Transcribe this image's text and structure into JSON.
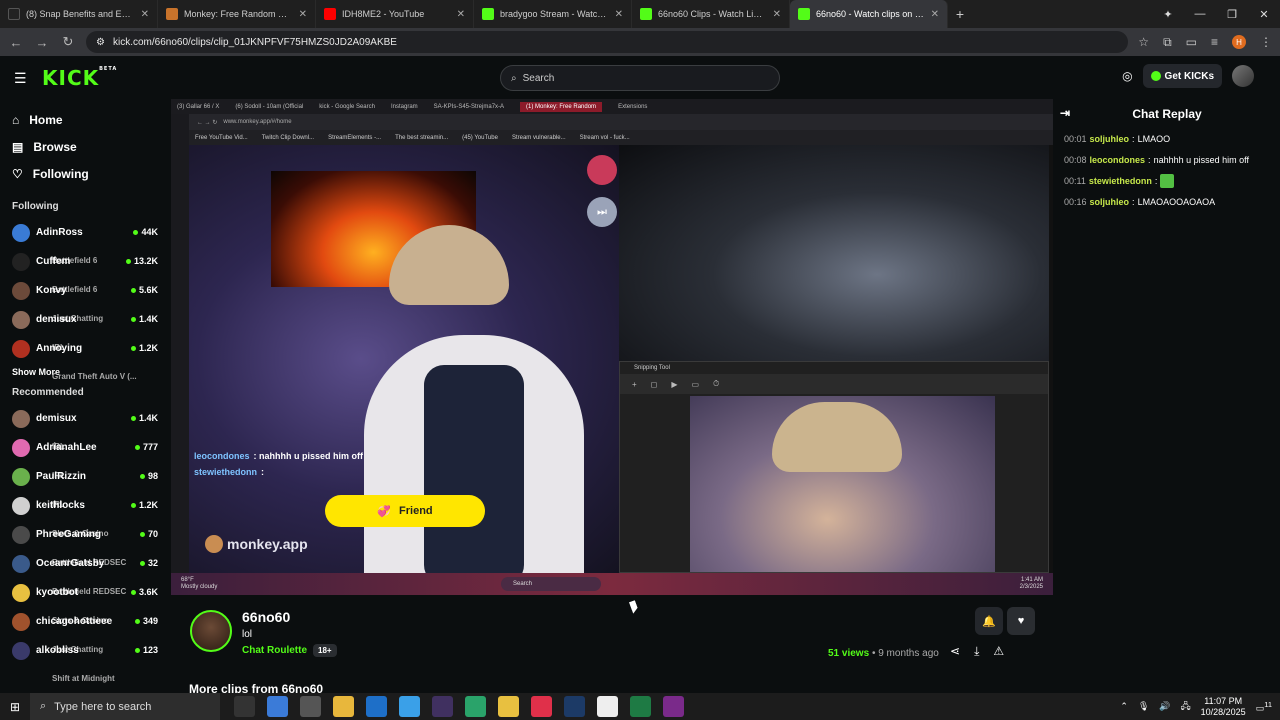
{
  "browser": {
    "tabs": [
      {
        "title": "(8) Snap Benefits and EBT Upda",
        "color": "#222"
      },
      {
        "title": "Monkey: Free Random Video",
        "color": "#c8732b"
      },
      {
        "title": "IDH8ME2 - YouTube",
        "color": "#ff0000"
      },
      {
        "title": "bradygoo Stream - Watch Live",
        "color": "#53fc18"
      },
      {
        "title": "66no60 Clips - Watch Live on Kick",
        "color": "#53fc18"
      },
      {
        "title": "66no60 - Watch clips on Kick",
        "color": "#53fc18"
      }
    ],
    "url": "kick.com/66no60/clips/clip_01JKNPFVF75HMZS0JD2A09AKBE"
  },
  "header": {
    "logo": "KICK",
    "logo_badge": "BETA",
    "search_placeholder": "Search",
    "get_kicks": "Get KICKs"
  },
  "sidebar": {
    "nav": [
      {
        "label": "Home",
        "icon": "home-icon"
      },
      {
        "label": "Browse",
        "icon": "browse-icon"
      },
      {
        "label": "Following",
        "icon": "heart-icon"
      }
    ],
    "following_title": "Following",
    "following": [
      {
        "name": "AdinRoss",
        "category": "Battlefield 6",
        "viewers": "44K",
        "color": "#3a7bd5"
      },
      {
        "name": "Cuffem",
        "category": "Battlefield 6",
        "viewers": "13.2K",
        "color": "#222"
      },
      {
        "name": "Konvy",
        "category": "Just Chatting",
        "viewers": "5.6K",
        "color": "#6c4a3a"
      },
      {
        "name": "demisux",
        "category": "IRL",
        "viewers": "1.4K",
        "color": "#8a6a5a"
      },
      {
        "name": "Annoying",
        "category": "Grand Theft Auto V (...",
        "viewers": "1.2K",
        "color": "#b03020"
      }
    ],
    "show_more": "Show More",
    "recommended_title": "Recommended",
    "recommended": [
      {
        "name": "demisux",
        "category": "IRL",
        "viewers": "1.4K",
        "color": "#8a6a5a"
      },
      {
        "name": "AdrianahLee",
        "category": "IRL",
        "viewers": "777",
        "color": "#e06ab0"
      },
      {
        "name": "PaulRizzin",
        "category": "IRL",
        "viewers": "98",
        "color": "#6ab04c"
      },
      {
        "name": "keithlocks",
        "category": "Slots & Casino",
        "viewers": "1.2K",
        "color": "#d0d0d0"
      },
      {
        "name": "PhreeGaming",
        "category": "Battlefield REDSEC",
        "viewers": "70",
        "color": "#4a4a4a"
      },
      {
        "name": "OceanrGatsby",
        "category": "Battlefield REDSEC",
        "viewers": "32",
        "color": "#3a5a8a"
      },
      {
        "name": "kyootbot",
        "category": "Slots & Casino",
        "viewers": "3.6K",
        "color": "#e8c040"
      },
      {
        "name": "chicagohottieee",
        "category": "Just Chatting",
        "viewers": "349",
        "color": "#a0522d"
      },
      {
        "name": "alkobliss",
        "category": "Shift at Midnight",
        "viewers": "123",
        "color": "#3a3a6a"
      }
    ]
  },
  "video": {
    "inner_tabs": [
      "(3) Gallar 66 / X",
      "(6) Sodoll - 10am (Official",
      "kick - Google Search",
      "Instagram",
      "SA-KPIs-S45-Strejma7x-A",
      "(1) Monkey: Free Random",
      "Extensions"
    ],
    "inner_url": "www.monkey.app/#/home",
    "inner_bookmarks": [
      "Free YouTube Vid...",
      "Twitch Clip Downl...",
      "StreamElements -...",
      "The best streamin...",
      "(45) YouTube",
      "Stream vulnerable...",
      "Stream vol - fuck..."
    ],
    "chat_overlay": [
      {
        "user": "leocondones",
        "text": ": nahhhh u pissed him off"
      },
      {
        "user": "stewiethedonn",
        "text": ":"
      }
    ],
    "friend_button": "Friend",
    "watermark": "monkey.app",
    "snip_title": "Snipping Tool",
    "taskbar_search": "Search",
    "weather": "68°F",
    "weather_desc": "Mostly cloudy",
    "inner_time": "1:41 AM",
    "inner_date": "2/3/2025"
  },
  "clip": {
    "channel": "66no60",
    "title": "lol",
    "category": "Chat Roulette",
    "age_badge": "18+",
    "views": "51",
    "views_label": "views",
    "ago": "• 9 months ago",
    "more_clips": "More clips from 66no60"
  },
  "chat": {
    "title": "Chat Replay",
    "messages": [
      {
        "time": "00:01",
        "user": "soljuhleo",
        "text": "LMAOO",
        "emote": false
      },
      {
        "time": "00:08",
        "user": "leocondones",
        "text": "nahhhh u pissed him off",
        "emote": false
      },
      {
        "time": "00:11",
        "user": "stewiethedonn",
        "text": "",
        "emote": true
      },
      {
        "time": "00:16",
        "user": "soljuhleo",
        "text": "LMAOAOOAOAOA",
        "emote": false
      }
    ]
  },
  "taskbar": {
    "search_placeholder": "Type here to search",
    "time": "11:07 PM",
    "date": "10/28/2025",
    "notif_count": "11"
  }
}
